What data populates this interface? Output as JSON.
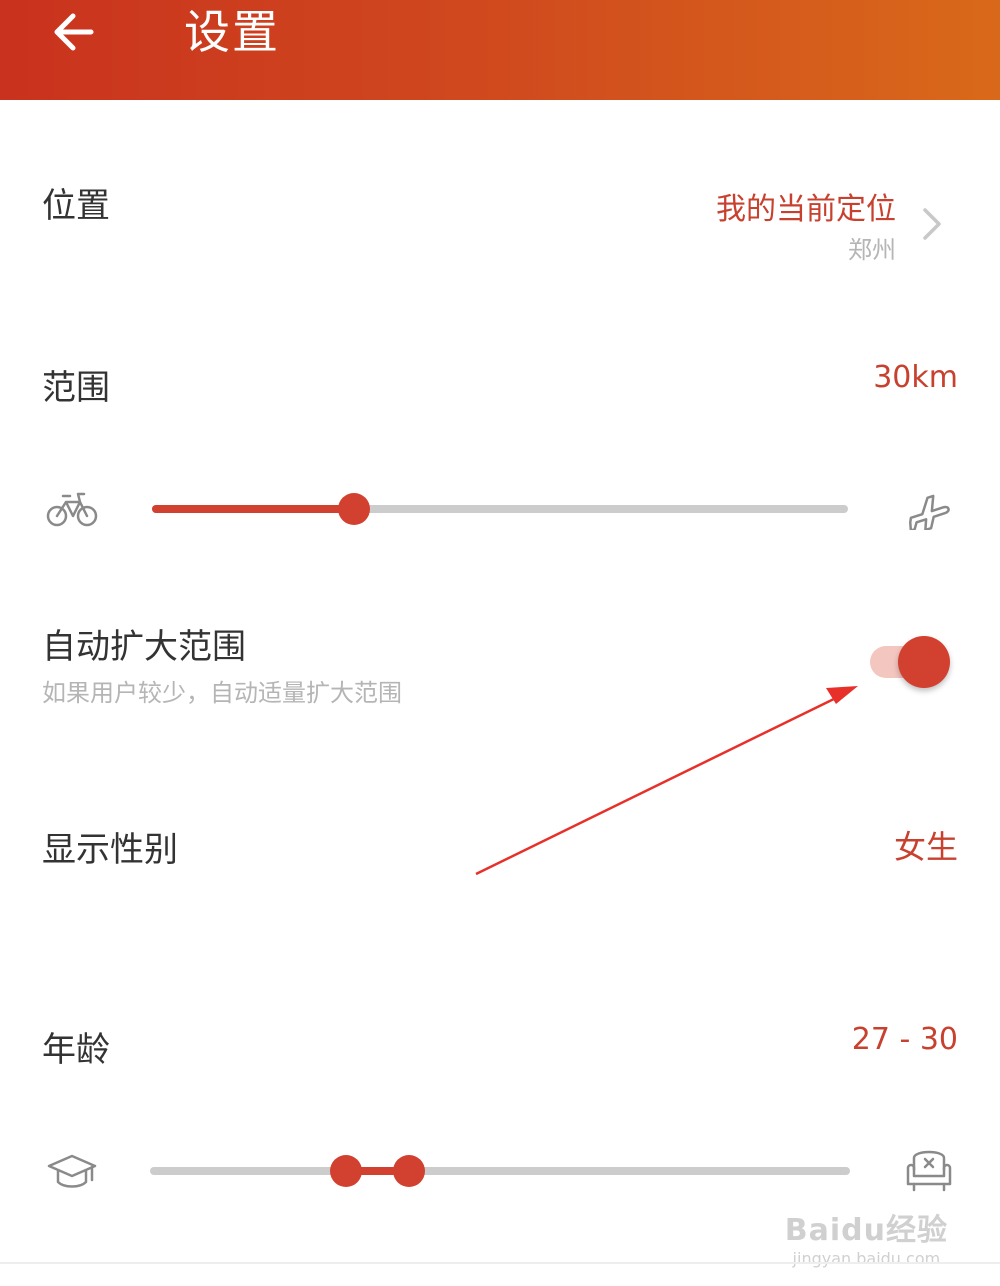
{
  "header": {
    "title": "设置",
    "back_icon": "arrow-left-icon",
    "gradient": [
      "#c9321e",
      "#d9691a"
    ]
  },
  "location": {
    "label": "位置",
    "value": "我的当前定位",
    "city": "郑州",
    "icon": "chevron-right-icon"
  },
  "range": {
    "label": "范围",
    "value": "30km",
    "slider_fraction": 0.29,
    "left_icon": "bicycle-icon",
    "right_icon": "airplane-icon"
  },
  "auto_expand": {
    "label": "自动扩大范围",
    "description": "如果用户较少，自动适量扩大范围",
    "enabled": true
  },
  "gender": {
    "label": "显示性别",
    "value": "女生"
  },
  "age": {
    "label": "年龄",
    "value": "27 - 30",
    "range_fraction": [
      0.28,
      0.37
    ],
    "left_icon": "graduation-cap-icon",
    "right_icon": "armchair-icon"
  },
  "colors": {
    "accent": "#d2402f",
    "accent_text": "#c8412f",
    "track": "#cccccc",
    "annotation_arrow": "#e8302a"
  },
  "watermark": {
    "main": "Baidu经验",
    "url": "jingyan.baidu.com"
  }
}
